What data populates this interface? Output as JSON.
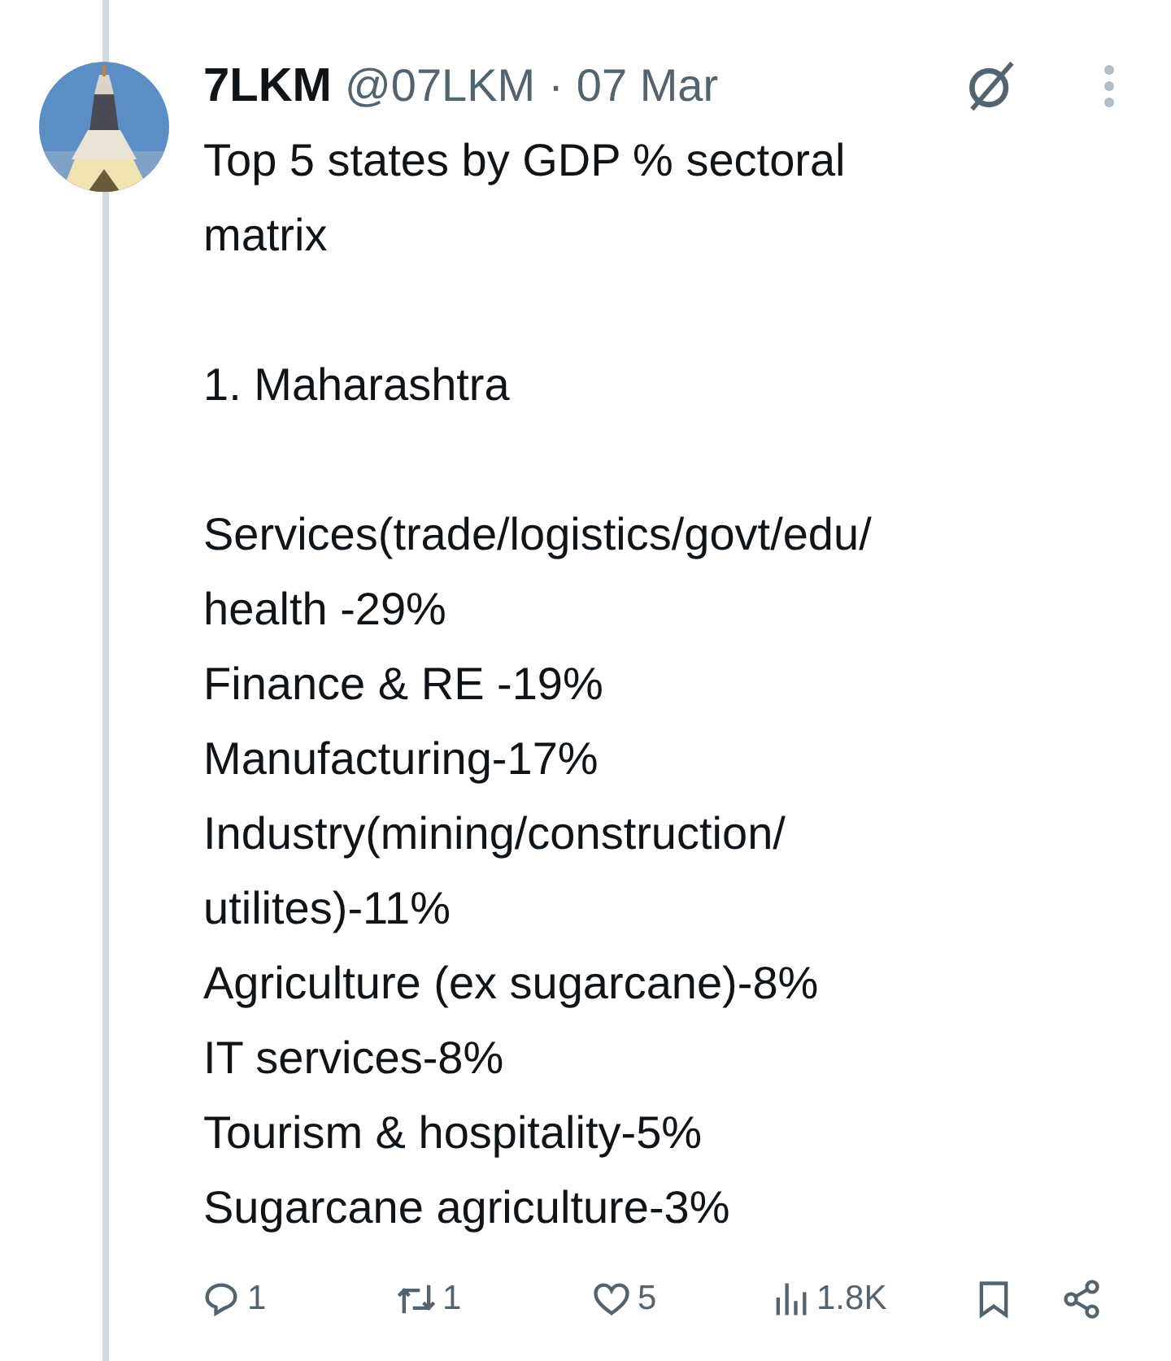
{
  "post": {
    "author_name": "7LKM",
    "handle": "@07LKM",
    "separator": "·",
    "date": "07 Mar",
    "body": [
      [
        "Top 5 states by GDP % sectoral",
        "matrix"
      ],
      [
        "1. Maharashtra"
      ],
      [
        "Services(trade/logistics/govt/edu/",
        "health -29%",
        "Finance & RE -19%",
        "Manufacturing-17%",
        "Industry(mining/construction/",
        "utilites)-11%",
        "Agriculture (ex sugarcane)-8%",
        "IT services-8%",
        "Tourism & hospitality-5%",
        "Sugarcane agriculture-3%"
      ]
    ]
  },
  "actions": [
    {
      "kind": "reply",
      "count": "1"
    },
    {
      "kind": "repost",
      "count": "1"
    },
    {
      "kind": "like",
      "count": "5"
    },
    {
      "kind": "views",
      "count": "1.8K"
    },
    {
      "kind": "bookmark"
    },
    {
      "kind": "share"
    }
  ]
}
